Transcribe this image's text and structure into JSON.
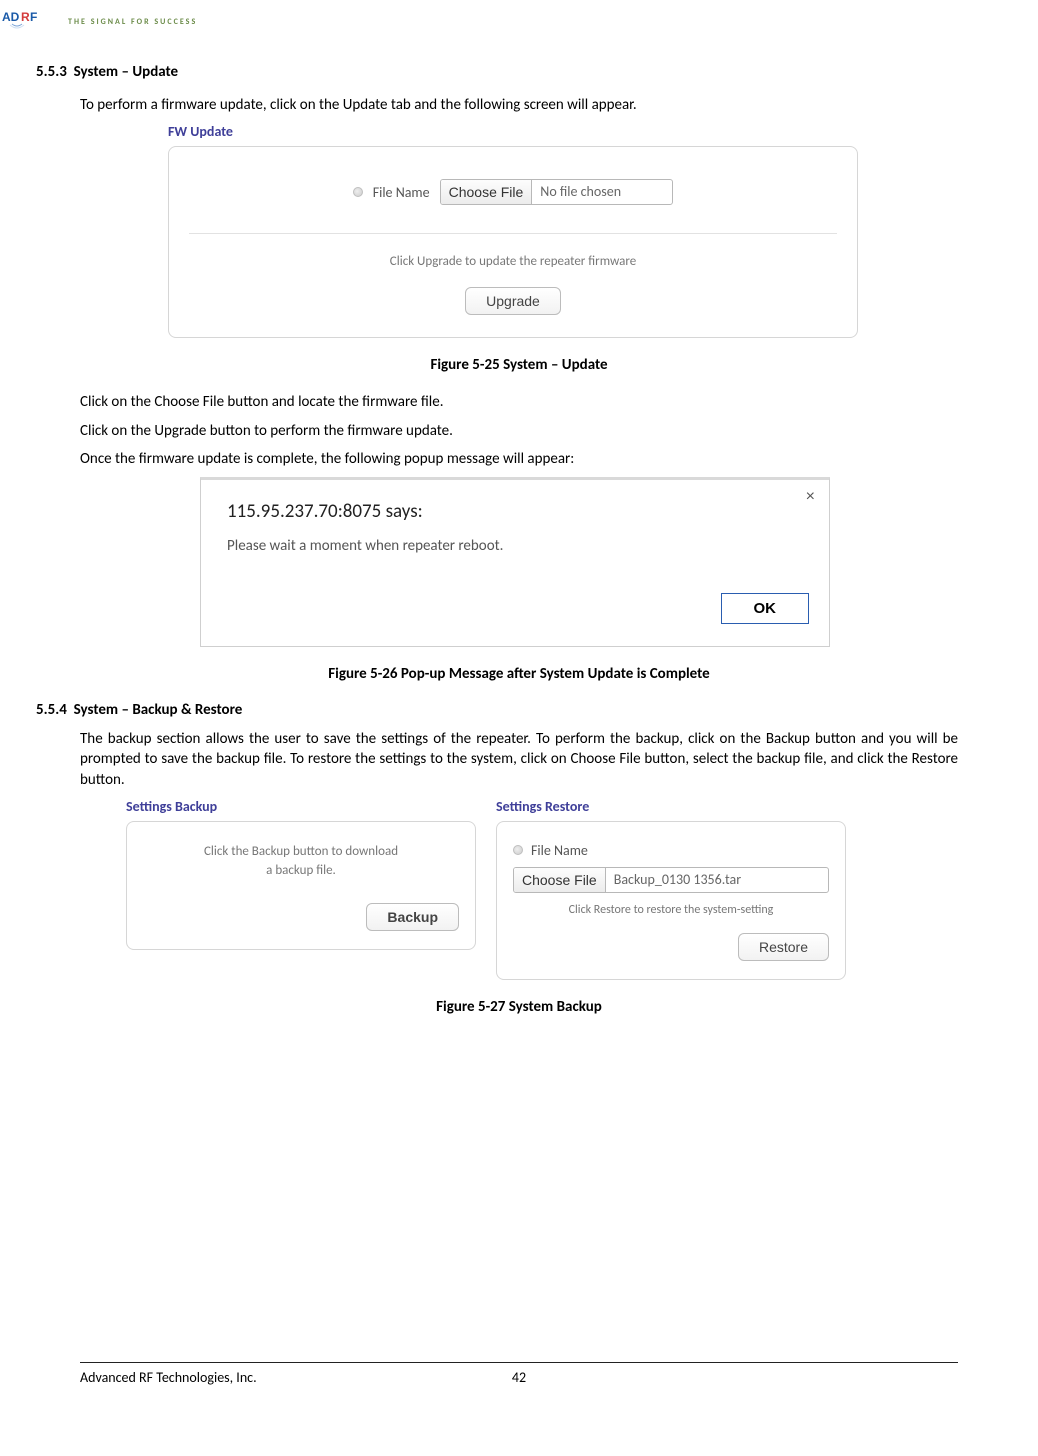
{
  "header": {
    "tagline": "THE SIGNAL FOR SUCCESS"
  },
  "section_553": {
    "number": "5.5.3",
    "title": "System – Update",
    "intro": "To perform a firmware update, click on the Update tab and the following screen will appear."
  },
  "fw_update": {
    "panel_title": "FW Update",
    "file_label": "File Name",
    "choose_btn": "Choose File",
    "no_file": "No file chosen",
    "hint": "Click Upgrade to update the repeater firmware",
    "upgrade_btn": "Upgrade"
  },
  "fig25": "Figure 5-25   System – Update",
  "instructions": {
    "l1": "Click on the Choose File button and locate the firmware file.",
    "l2": "Click on the Upgrade button to perform the firmware update.",
    "l3": "Once the firmware update is complete, the following popup message will appear:"
  },
  "popup": {
    "address": "115.95.237.70:8075 says:",
    "message": "Please wait a moment when repeater reboot.",
    "ok": "OK",
    "close": "×"
  },
  "fig26": "Figure 5-26   Pop-up Message after System Update is Complete",
  "section_554": {
    "number": "5.5.4",
    "title": "System – Backup & Restore",
    "body": "The backup section allows the user to save the settings of the repeater. To perform the backup, click on the Backup button and you will be prompted to save the backup file.  To restore the settings to the system, click on Choose File button, select the backup file, and click the Restore button."
  },
  "backup": {
    "title": "Settings Backup",
    "hint1": "Click the Backup button to download",
    "hint2": "a backup file.",
    "btn": "Backup"
  },
  "restore": {
    "title": "Settings Restore",
    "file_label": "File Name",
    "choose_btn": "Choose File",
    "file_name": "Backup_0130 1356.tar",
    "hint": "Click Restore to restore the system-setting",
    "btn": "Restore"
  },
  "fig27": "Figure 5-27   System Backup",
  "footer": {
    "company": "Advanced RF Technologies, Inc.",
    "page": "42"
  }
}
